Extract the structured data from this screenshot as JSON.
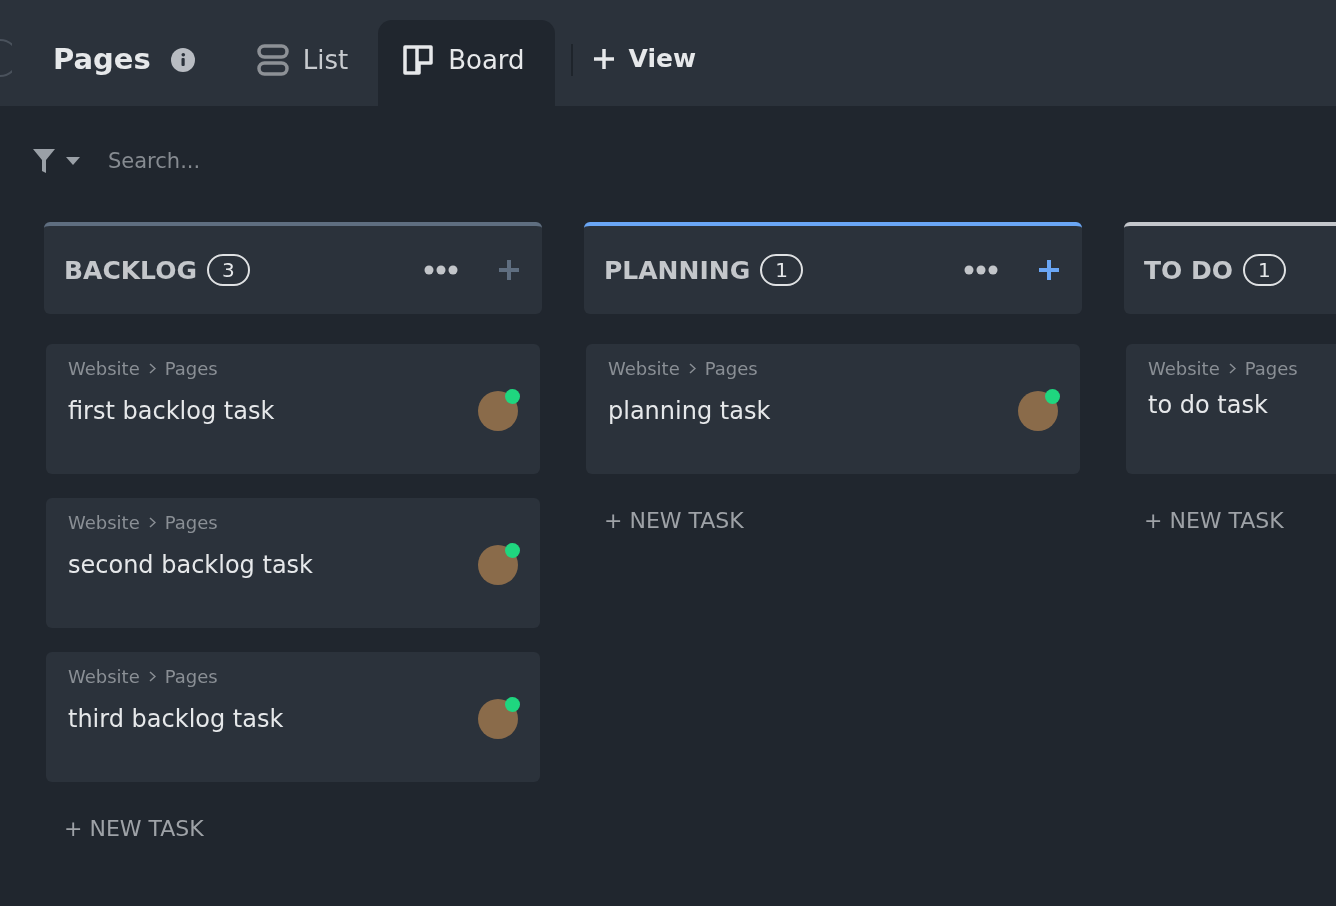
{
  "header": {
    "title": "Pages",
    "tabs": [
      {
        "kind": "list",
        "label": "List",
        "selected": false
      },
      {
        "kind": "board",
        "label": "Board",
        "selected": true
      }
    ],
    "add_view": "View"
  },
  "search": {
    "placeholder": "Search..."
  },
  "columns": [
    {
      "name": "BACKLOG",
      "count": "3",
      "color": "#5f6e80",
      "tasks": [
        {
          "path": "Website",
          "list": "Pages",
          "title": "first backlog task",
          "assigned": true
        },
        {
          "path": "Website",
          "list": "Pages",
          "title": "second backlog task",
          "assigned": true
        },
        {
          "path": "Website",
          "list": "Pages",
          "title": "third backlog task",
          "assigned": true
        }
      ],
      "new_task": "+ NEW TASK"
    },
    {
      "name": "PLANNING",
      "count": "1",
      "color": "#6aa6f5",
      "tasks": [
        {
          "path": "Website",
          "list": "Pages",
          "title": "planning task",
          "assigned": true
        }
      ],
      "new_task": "+ NEW TASK"
    },
    {
      "name": "TO DO",
      "count": "1",
      "color": "#c4c7cc",
      "tasks": [
        {
          "path": "Website",
          "list": "Pages",
          "title": "to do task",
          "assigned": false
        }
      ],
      "new_task": "+ NEW TASK"
    }
  ]
}
